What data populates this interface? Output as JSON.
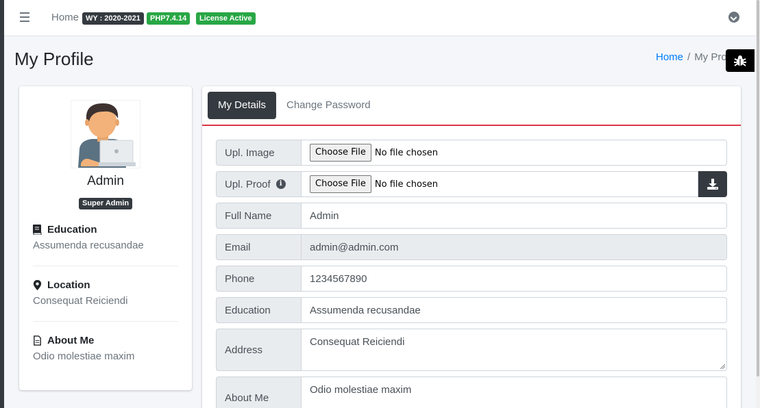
{
  "navbar": {
    "home": "Home",
    "badges": [
      "WY : 2020-2021",
      "PHP7.4.14",
      "License Active"
    ]
  },
  "header": {
    "title": "My Profile",
    "breadcrumb_home": "Home",
    "breadcrumb_sep": "/",
    "breadcrumb_current": "My Profile"
  },
  "profile": {
    "name": "Admin",
    "role": "Super Admin",
    "education_title": "Education",
    "education_value": "Assumenda recusandae",
    "location_title": "Location",
    "location_value": "Consequat Reiciendi",
    "about_title": "About Me",
    "about_value": "Odio molestiae maxim"
  },
  "tabs": {
    "active": "My Details",
    "other": "Change Password"
  },
  "form": {
    "image_label": "Upl. Image",
    "proof_label": "Upl. Proof",
    "choose_file": "Choose File",
    "no_file": "No file chosen",
    "fullname_label": "Full Name",
    "fullname_value": "Admin",
    "email_label": "Email",
    "email_value": "admin@admin.com",
    "phone_label": "Phone",
    "phone_value": "1234567890",
    "education_label": "Education",
    "education_value": "Assumenda recusandae",
    "address_label": "Address",
    "address_value": "Consequat Reiciendi",
    "about_label": "About Me",
    "about_value": "Odio molestiae maxim"
  },
  "icons": {
    "menu": "hamburger-icon",
    "dropdown": "chevron-circle-down-icon",
    "bug": "bug-icon",
    "education": "book-icon",
    "location": "map-marker-icon",
    "about": "file-text-icon",
    "info": "info-circle-icon",
    "download": "download-icon"
  },
  "colors": {
    "accent_red": "#dc3545",
    "dark": "#343a40",
    "green": "#28a745",
    "link": "#007bff"
  }
}
